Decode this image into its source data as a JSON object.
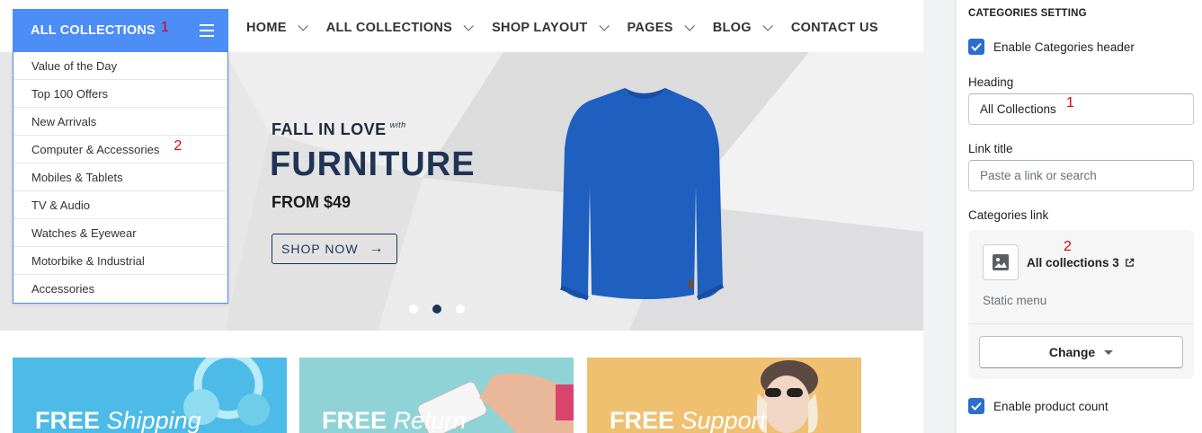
{
  "store": {
    "all_collections_button": "ALL COLLECTIONS",
    "annotation_1": "1",
    "annotation_2": "2",
    "nav": [
      {
        "label": "HOME",
        "has_dropdown": true
      },
      {
        "label": "ALL COLLECTIONS",
        "has_dropdown": true
      },
      {
        "label": "SHOP LAYOUT",
        "has_dropdown": true
      },
      {
        "label": "PAGES",
        "has_dropdown": true
      },
      {
        "label": "BLOG",
        "has_dropdown": true
      },
      {
        "label": "CONTACT US",
        "has_dropdown": false
      }
    ],
    "dropdown_items": [
      "Value of the Day",
      "Top 100 Offers",
      "New Arrivals",
      "Computer & Accessories",
      "Mobiles & Tablets",
      "TV & Audio",
      "Watches & Eyewear",
      "Motorbike & Industrial",
      "Accessories"
    ],
    "hero": {
      "line1": "FALL IN LOVE",
      "line1_suffix": "with",
      "headline": "FURNITURE",
      "price_line": "FROM $49",
      "cta": "SHOP NOW",
      "slide_count": 3,
      "active_slide": 2
    },
    "promos": [
      {
        "bold": "FREE",
        "italic": "Shipping",
        "color": "#4dbbe8"
      },
      {
        "bold": "FREE",
        "italic": "Return",
        "color": "#8fd3d6"
      },
      {
        "bold": "FREE",
        "italic": "Support",
        "color": "#f0c071"
      }
    ],
    "colors": {
      "accent": "#4c8df6",
      "navy": "#1f3455",
      "annotation": "#e0000d"
    }
  },
  "settings": {
    "section_title": "CATEGORIES SETTING",
    "enable_header_label": "Enable Categories header",
    "enable_header_checked": true,
    "heading_label": "Heading",
    "heading_value": "All Collections",
    "heading_annotation": "1",
    "link_title_label": "Link title",
    "link_title_placeholder": "Paste a link or search",
    "categories_link_label": "Categories link",
    "category_name": "All collections 3",
    "category_annotation": "2",
    "category_sub": "Static menu",
    "change_button": "Change",
    "enable_count_label": "Enable product count",
    "enable_count_checked": true,
    "colors": {
      "primary": "#2c6ecb"
    }
  }
}
